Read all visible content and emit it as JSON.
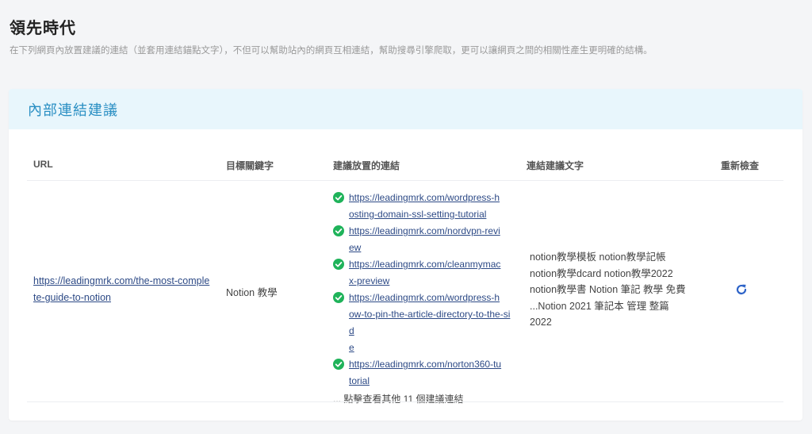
{
  "page": {
    "title": "領先時代",
    "description": "在下列網頁內放置建議的連結（並套用連結錨點文字），不但可以幫助站內的網頁互相連結，幫助搜尋引擎爬取，更可以讓網頁之間的相關性產生更明確的結構。"
  },
  "card": {
    "title": "內部連結建議",
    "columns": {
      "url": "URL",
      "keyword": "目標關鍵字",
      "links": "建議放置的連結",
      "anchor": "連結建議文字",
      "recheck": "重新檢查"
    },
    "row": {
      "url_line1": "https://leadingmrk.com/the-most-comple",
      "url_line2": "te-guide-to-notion",
      "keyword": "Notion 教學",
      "links": [
        {
          "line1": "https://leadingmrk.com/wordpress-h",
          "line2": "osting-domain-ssl-setting-tutorial"
        },
        {
          "line1": "https://leadingmrk.com/nordvpn-revi",
          "line2": "ew"
        },
        {
          "line1": "https://leadingmrk.com/cleanmymac",
          "line2": "x-preview"
        },
        {
          "line1": "https://leadingmrk.com/wordpress-h",
          "line2": "ow-to-pin-the-article-directory-to-the-sid",
          "line3": "e"
        },
        {
          "line1": "https://leadingmrk.com/norton360-tu",
          "line2": "torial"
        }
      ],
      "more_text": "... 點擊查看其他 11 個建議連結",
      "anchor_lines": [
        "notion教學模板 notion教學記帳",
        "notion教學dcard notion教學2022",
        "notion教學書 Notion 筆記 教學 免費",
        "...Notion 2021 筆記本 管理 整篇",
        "2022"
      ]
    }
  },
  "colors": {
    "accent": "#2a8fc3",
    "header_bg": "#e8f6fc",
    "link": "#2d4a86",
    "check": "#1fb35a",
    "recheck_icon": "#2d63c8"
  },
  "icons": {
    "check": "check-circle-icon",
    "recheck": "refresh-icon"
  }
}
